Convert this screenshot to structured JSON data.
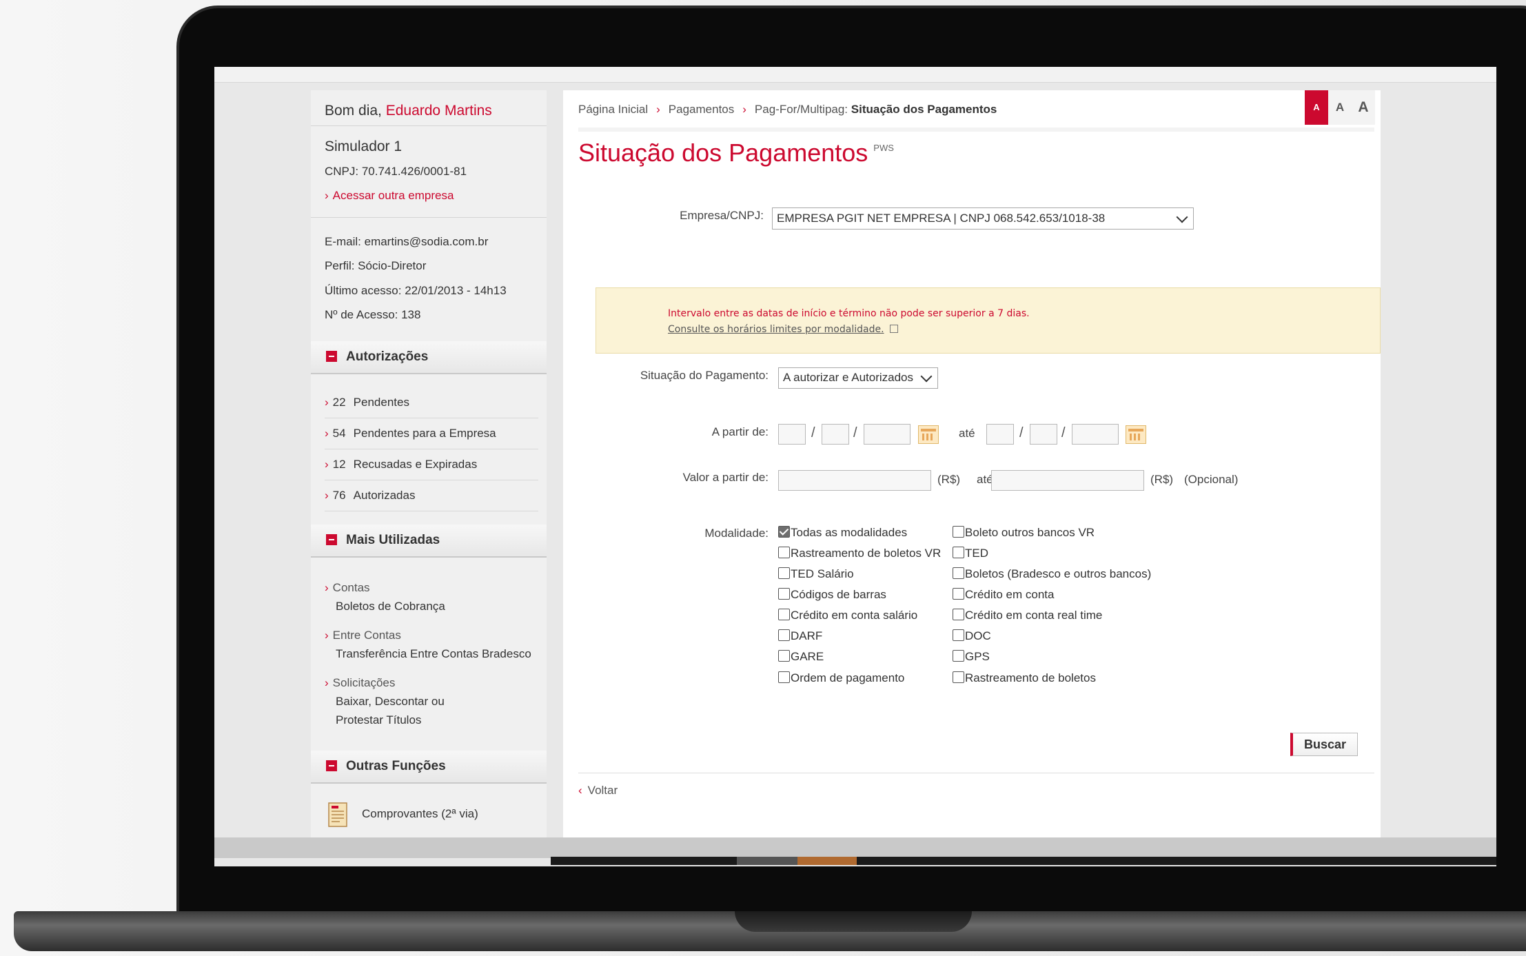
{
  "sidebar": {
    "greeting": "Bom dia, ",
    "user_name": "Eduardo Martins",
    "company": "Simulador 1",
    "cnpj": "CNPJ: 70.741.426/0001-81",
    "other_company_link": "Acessar outra empresa",
    "email": "E-mail: emartins@sodia.com.br",
    "profile": "Perfil: Sócio-Diretor",
    "last_access": "Último acesso: 22/01/2013 - 14h13",
    "access_count": "Nº de Acesso: 138",
    "autorizacoes": {
      "title": "Autorizações",
      "items": [
        {
          "count": "22",
          "label": "Pendentes"
        },
        {
          "count": "54",
          "label": "Pendentes para a Empresa"
        },
        {
          "count": "12",
          "label": "Recusadas e Expiradas"
        },
        {
          "count": "76",
          "label": "Autorizadas"
        }
      ]
    },
    "mais_utilizadas": {
      "title": "Mais Utilizadas",
      "items": [
        {
          "category": "Contas",
          "lines": [
            "Boletos de Cobrança"
          ]
        },
        {
          "category": "Entre Contas",
          "lines": [
            "Transferência Entre Contas Bradesco"
          ]
        },
        {
          "category": "Solicitações",
          "lines": [
            "Baixar, Descontar ou",
            "Protestar Títulos"
          ]
        }
      ]
    },
    "outras_funcoes": {
      "title": "Outras Funções",
      "comprovantes": "Comprovantes (2ª via)"
    }
  },
  "breadcrumb": {
    "home": "Página Inicial",
    "payments": "Pagamentos",
    "prefix": "Pag-For/Multipag: ",
    "current": "Situação dos Pagamentos"
  },
  "font_buttons": [
    "A",
    "A",
    "A"
  ],
  "page": {
    "title": "Situação dos Pagamentos",
    "title_tag": "PWS"
  },
  "form": {
    "empresa_label": "Empresa/CNPJ:",
    "empresa_value": "EMPRESA PGIT NET EMPRESA | CNPJ 068.542.653/1018-38",
    "alert_message": "Intervalo entre as datas de início e término não pode ser superior a 7 dias.",
    "alert_link": "Consulte os horários limites por modalidade.",
    "situacao_label": "Situação do Pagamento:",
    "situacao_value": "A autorizar e Autorizados",
    "date_from_label": "A partir de:",
    "date_until_label": "até",
    "valor_label": "Valor a partir de:",
    "currency_1": "(R$)",
    "valor_until_label": "até",
    "currency_2": "(R$)",
    "optional": "(Opcional)",
    "modalidade_label": "Modalidade:",
    "modalidades_left": [
      {
        "label": "Todas as modalidades",
        "checked": true
      },
      {
        "label": "Rastreamento de boletos VR",
        "checked": false
      },
      {
        "label": "TED Salário",
        "checked": false
      },
      {
        "label": "Códigos de barras",
        "checked": false
      },
      {
        "label": "Crédito em conta salário",
        "checked": false
      },
      {
        "label": "DARF",
        "checked": false
      },
      {
        "label": "GARE",
        "checked": false
      },
      {
        "label": "Ordem de pagamento",
        "checked": false
      }
    ],
    "modalidades_right": [
      {
        "label": "Boleto outros bancos VR",
        "checked": false
      },
      {
        "label": "TED",
        "checked": false
      },
      {
        "label": "Boletos (Bradesco e outros bancos)",
        "checked": false
      },
      {
        "label": "Crédito em conta",
        "checked": false
      },
      {
        "label": "Crédito em conta real time",
        "checked": false
      },
      {
        "label": "DOC",
        "checked": false
      },
      {
        "label": "GPS",
        "checked": false
      },
      {
        "label": "Rastreamento de boletos",
        "checked": false
      }
    ],
    "search_button": "Buscar"
  },
  "back_link": "Voltar",
  "colors": {
    "brand_red": "#cc092f",
    "alert_bg": "#fbf3d6"
  }
}
